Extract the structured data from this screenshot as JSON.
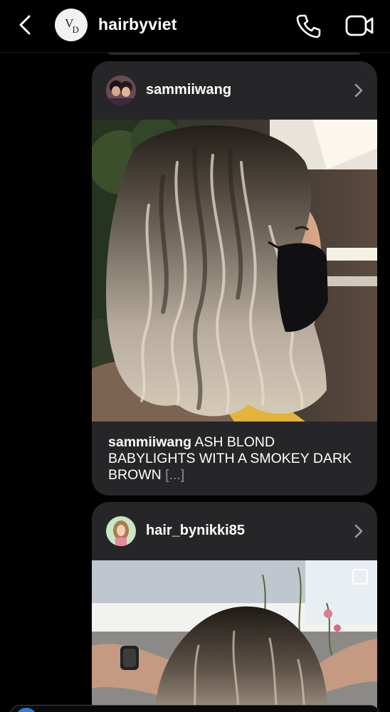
{
  "header": {
    "username": "hairbyviet",
    "avatar_text": "VD",
    "back_icon": "chevron-left-icon",
    "call_icon": "phone-icon",
    "video_icon": "video-camera-icon"
  },
  "posts": [
    {
      "username": "sammiiwang",
      "caption_user": "sammiiwang",
      "caption_text": "ASH BLOND BABYLIGHTS  WITH A  SMOKEY DARK BROWN",
      "caption_more": "[...]"
    },
    {
      "username": "hair_bynikki85"
    }
  ],
  "colors": {
    "background": "#000000",
    "card": "#262628",
    "muted": "#8e8e93"
  }
}
